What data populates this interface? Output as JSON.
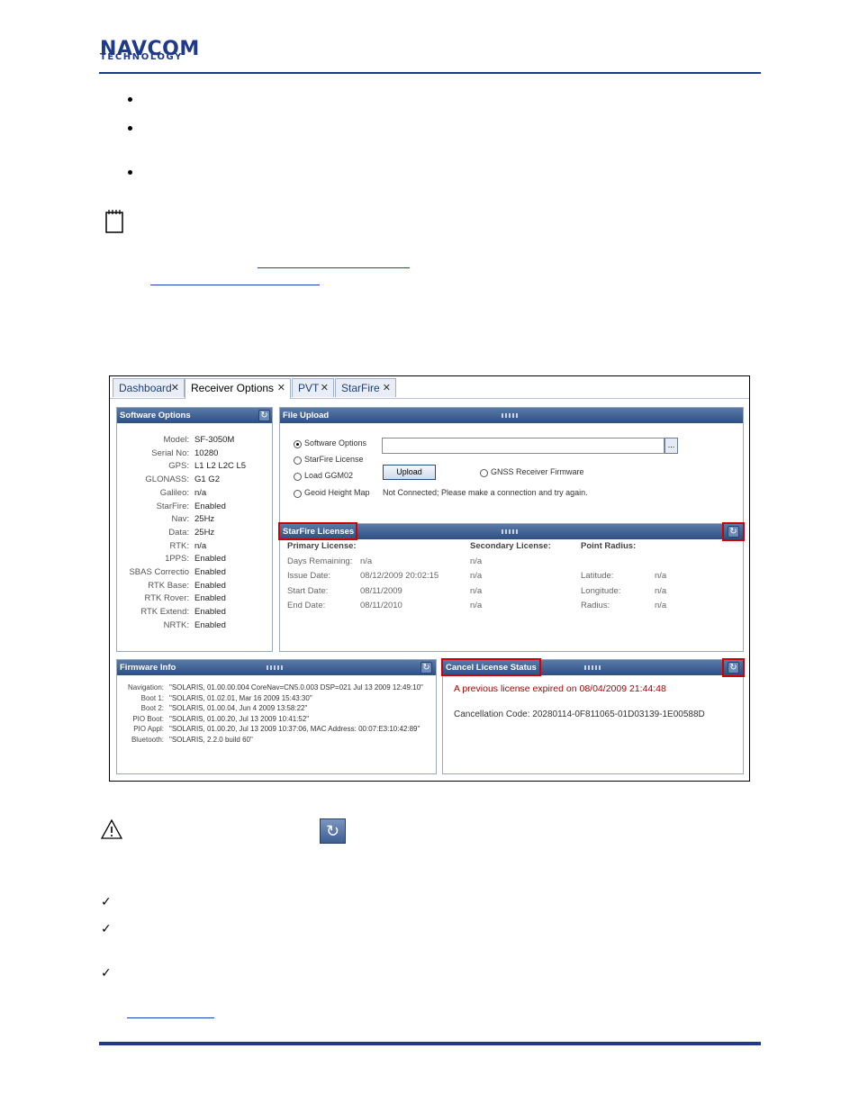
{
  "header": {
    "logo_top": "NAVCOM",
    "logo_bottom": "TECHNOLOGY"
  },
  "icons": {
    "note": "notepad-icon",
    "warning": "warning-triangle-icon",
    "refresh": "refresh-icon",
    "check": "checkmark-icon"
  },
  "tabs": [
    {
      "label": "Dashboard"
    },
    {
      "label": "Receiver Options"
    },
    {
      "label": "PVT"
    },
    {
      "label": "StarFire"
    }
  ],
  "tab_close_glyph": "✕",
  "software_options": {
    "title": "Software Options",
    "rows": [
      {
        "label": "Model:",
        "value": "SF-3050M"
      },
      {
        "label": "Serial No:",
        "value": "10280"
      },
      {
        "label": "GPS:",
        "value": "L1 L2 L2C L5"
      },
      {
        "label": "GLONASS:",
        "value": "G1 G2"
      },
      {
        "label": "Galileo:",
        "value": "n/a"
      },
      {
        "label": "StarFire:",
        "value": "Enabled"
      },
      {
        "label": "Nav:",
        "value": "25Hz"
      },
      {
        "label": "Data:",
        "value": "25Hz"
      },
      {
        "label": "RTK:",
        "value": "n/a"
      },
      {
        "label": "1PPS:",
        "value": "Enabled"
      },
      {
        "label": "SBAS Correctio",
        "value": "Enabled"
      },
      {
        "label": "RTK Base:",
        "value": "Enabled"
      },
      {
        "label": "RTK Rover:",
        "value": "Enabled"
      },
      {
        "label": "RTK Extend:",
        "value": "Enabled"
      },
      {
        "label": "NRTK:",
        "value": "Enabled"
      }
    ]
  },
  "file_upload": {
    "title": "File Upload",
    "options": [
      "Software Options",
      "StarFire License",
      "Load GGM02",
      "Geoid Height Map"
    ],
    "gnss_option": "GNSS Receiver Firmware",
    "browse_label": "...",
    "upload_label": "Upload",
    "status": "Not Connected; Please make a connection and try again."
  },
  "starfire_licenses": {
    "title": "StarFire Licenses",
    "primary_header": "Primary License:",
    "secondary_header": "Secondary License:",
    "point_header": "Point Radius:",
    "rows": [
      {
        "label": "Days Remaining:",
        "primary": "n/a",
        "secondary": "n/a",
        "plabel": "",
        "pvalue": ""
      },
      {
        "label": "Issue Date:",
        "primary": "08/12/2009 20:02:15",
        "secondary": "n/a",
        "plabel": "Latitude:",
        "pvalue": "n/a"
      },
      {
        "label": "Start Date:",
        "primary": "08/11/2009",
        "secondary": "n/a",
        "plabel": "Longitude:",
        "pvalue": "n/a"
      },
      {
        "label": "End Date:",
        "primary": "08/11/2010",
        "secondary": "n/a",
        "plabel": "Radius:",
        "pvalue": "n/a"
      }
    ]
  },
  "firmware_info": {
    "title": "Firmware Info",
    "rows": [
      {
        "label": "Navigation:",
        "value": "\"SOLARIS, 01.00.00.004 CoreNav=CN5.0.003 DSP=021 Jul 13 2009 12:49:10\""
      },
      {
        "label": "Boot 1:",
        "value": "\"SOLARIS, 01.02.01, Mar 16 2009 15:43:30\""
      },
      {
        "label": "Boot 2:",
        "value": "\"SOLARIS, 01.00.04, Jun 4 2009 13:58:22\""
      },
      {
        "label": "PIO Boot:",
        "value": "\"SOLARIS, 01.00.20, Jul 13 2009 10:41:52\""
      },
      {
        "label": "PIO Appl:",
        "value": "\"SOLARIS, 01.00.20, Jul 13 2009 10:37:06, MAC Address: 00:07:E3:10:42:89\""
      },
      {
        "label": "Bluetooth:",
        "value": "\"SOLARIS, 2.2.0 build 60\""
      }
    ]
  },
  "cancel_license": {
    "title": "Cancel License Status",
    "message": "A previous license expired on 08/04/2009 21:44:48",
    "code": "Cancellation Code: 20280114-0F811065-01D03139-1E00588D",
    "message_color": "#b00000"
  }
}
